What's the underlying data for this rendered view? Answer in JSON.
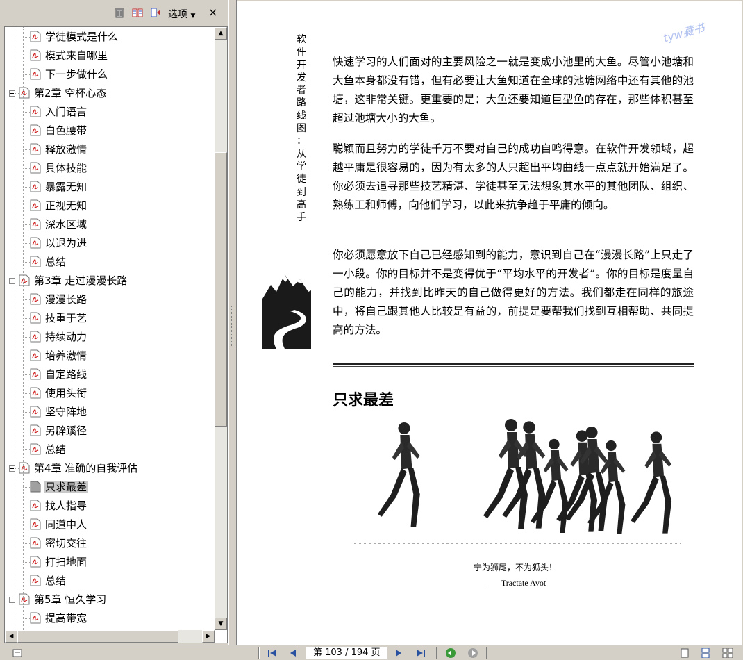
{
  "bookmarks_panel": {
    "options_label": "选项",
    "close_label": "×",
    "items": [
      {
        "level": 2,
        "label": "学徒模式是什么"
      },
      {
        "level": 2,
        "label": "模式来自哪里"
      },
      {
        "level": 2,
        "label": "下一步做什么"
      },
      {
        "level": 1,
        "label": "第2章 空杯心态"
      },
      {
        "level": 2,
        "label": "入门语言"
      },
      {
        "level": 2,
        "label": "白色腰带"
      },
      {
        "level": 2,
        "label": "释放激情"
      },
      {
        "level": 2,
        "label": "具体技能"
      },
      {
        "level": 2,
        "label": "暴露无知"
      },
      {
        "level": 2,
        "label": "正视无知"
      },
      {
        "level": 2,
        "label": "深水区域"
      },
      {
        "level": 2,
        "label": "以退为进"
      },
      {
        "level": 2,
        "label": "总结"
      },
      {
        "level": 1,
        "label": "第3章 走过漫漫长路"
      },
      {
        "level": 2,
        "label": "漫漫长路"
      },
      {
        "level": 2,
        "label": "技重于艺"
      },
      {
        "level": 2,
        "label": "持续动力"
      },
      {
        "level": 2,
        "label": "培养激情"
      },
      {
        "level": 2,
        "label": "自定路线"
      },
      {
        "level": 2,
        "label": "使用头衔"
      },
      {
        "level": 2,
        "label": "坚守阵地"
      },
      {
        "level": 2,
        "label": "另辟蹊径"
      },
      {
        "level": 2,
        "label": "总结"
      },
      {
        "level": 1,
        "label": "第4章 准确的自我评估"
      },
      {
        "level": 2,
        "label": "只求最差",
        "selected": true
      },
      {
        "level": 2,
        "label": "找人指导"
      },
      {
        "level": 2,
        "label": "同道中人"
      },
      {
        "level": 2,
        "label": "密切交往"
      },
      {
        "level": 2,
        "label": "打扫地面"
      },
      {
        "level": 2,
        "label": "总结"
      },
      {
        "level": 1,
        "label": "第5章 恒久学习"
      },
      {
        "level": 2,
        "label": "提高带宽"
      }
    ]
  },
  "page": {
    "vertical_title": [
      "软",
      "件",
      "开",
      "发",
      "者",
      "路",
      "线",
      "图",
      "：",
      "从",
      "学",
      "徒",
      "到",
      "高",
      "手"
    ],
    "watermark": "tyw藏书",
    "paragraphs": [
      "快速学习的人们面对的主要风险之一就是变成小池里的大鱼。尽管小池塘和大鱼本身都没有错，但有必要让大鱼知道在全球的池塘网络中还有其他的池塘，这非常关键。更重要的是：大鱼还要知道巨型鱼的存在，那些体积甚至超过池塘大小的大鱼。",
      "聪颖而且努力的学徒千万不要对自己的成功自鸣得意。在软件开发领域，超越平庸是很容易的，因为有太多的人只超出平均曲线一点点就开始满足了。你必须去追寻那些技艺精湛、学徒甚至无法想象其水平的其他团队、组织、熟练工和师傅，向他们学习，以此来抗争趋于平庸的倾向。",
      "你必须愿意放下自己已经感知到的能力，意识到自己在“漫漫长路”上只走了一小段。你的目标并不是变得优于“平均水平的开发者”。你的目标是度量自己的能力，并找到比昨天的自己做得更好的方法。我们都走在同样的旅途中，将自己跟其他人比较是有益的，前提是要帮我们找到互相帮助、共同提高的方法。"
    ],
    "section_title": "只求最差",
    "quote": "宁为狮尾，不为狐头！",
    "quote_source": "——Tractate Avot"
  },
  "statusbar": {
    "page_indicator": "第 103 / 194 页"
  }
}
